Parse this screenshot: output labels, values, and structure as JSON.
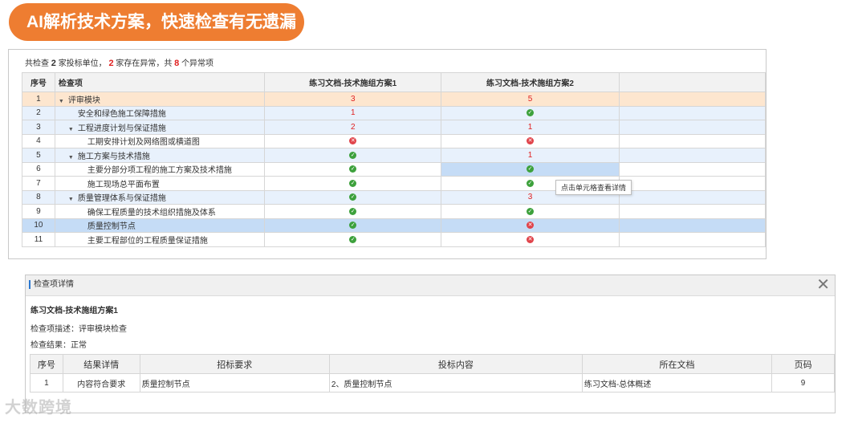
{
  "banner": {
    "title": "AI解析技术方案，快速检查有无遗漏"
  },
  "summary": {
    "prefix": "共检查",
    "bidders": "2",
    "mid1": "家投标单位，",
    "abnormal": "2",
    "mid2": "家存在异常，共",
    "issues": "8",
    "suffix": "个异常项"
  },
  "table": {
    "headers": {
      "no": "序号",
      "item": "检查项",
      "plan1": "练习文档-技术施组方案1",
      "plan2": "练习文档-技术施组方案2"
    },
    "rows": [
      {
        "no": "1",
        "item": "评审模块",
        "p1": "3",
        "p2": "5"
      },
      {
        "no": "2",
        "item": "安全和绿色施工保障措施",
        "p1": "1",
        "p2": "ok"
      },
      {
        "no": "3",
        "item": "工程进度计划与保证措施",
        "p1": "2",
        "p2": "1"
      },
      {
        "no": "4",
        "item": "工期安排计划及网络图或横道图",
        "p1": "err",
        "p2": "err"
      },
      {
        "no": "5",
        "item": "施工方案与技术措施",
        "p1": "ok",
        "p2": "1"
      },
      {
        "no": "6",
        "item": "主要分部分项工程的施工方案及技术措施",
        "p1": "ok",
        "p2": "ok"
      },
      {
        "no": "7",
        "item": "施工现场总平面布置",
        "p1": "ok",
        "p2": "ok"
      },
      {
        "no": "8",
        "item": "质量管理体系与保证措施",
        "p1": "ok",
        "p2": "3"
      },
      {
        "no": "9",
        "item": "确保工程质量的技术组织措施及体系",
        "p1": "ok",
        "p2": "ok"
      },
      {
        "no": "10",
        "item": "质量控制节点",
        "p1": "ok",
        "p2": "err"
      },
      {
        "no": "11",
        "item": "主要工程部位的工程质量保证措施",
        "p1": "ok",
        "p2": "err"
      }
    ]
  },
  "tooltip": "点击单元格查看详情",
  "detail": {
    "title": "检查项详情",
    "doc": "练习文档-技术施组方案1",
    "desc": "检查项描述：评审模块检查",
    "result": "检查结果：正常",
    "headers": {
      "no": "序号",
      "result": "结果详情",
      "req": "招标要求",
      "content": "投标内容",
      "file": "所在文档",
      "page": "页码"
    },
    "row": {
      "no": "1",
      "result": "内容符合要求",
      "req": "质量控制节点",
      "content": "2、质量控制节点",
      "file": "练习文档-总体概述",
      "page": "9"
    }
  },
  "watermark": "大数跨境",
  "icons": {
    "close": "close-icon",
    "ok": "check-circle-icon",
    "err": "error-circle-icon"
  },
  "colors": {
    "banner": "#ee7d31",
    "error": "#e02020",
    "ok": "#3da13c",
    "selected": "#c5dcf6"
  }
}
